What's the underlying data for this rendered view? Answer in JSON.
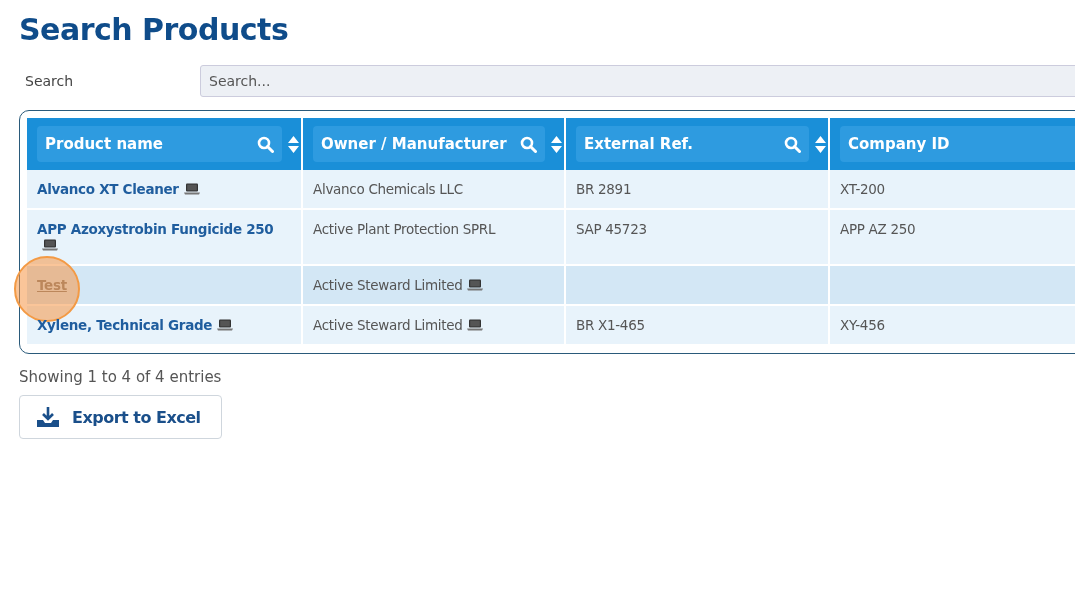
{
  "page": {
    "title": "Search Products"
  },
  "search": {
    "label": "Search",
    "placeholder": "Search..."
  },
  "table": {
    "columns": [
      {
        "label": "Product name"
      },
      {
        "label": "Owner / Manufacturer"
      },
      {
        "label": "External Ref."
      },
      {
        "label": "Company ID"
      }
    ],
    "rows": [
      {
        "highlighted": false,
        "cells": [
          {
            "text": "Alvanco XT Cleaner",
            "device_icon": true
          },
          {
            "text": "Alvanco Chemicals LLC",
            "device_icon": false
          },
          {
            "text": "BR 2891",
            "device_icon": false
          },
          {
            "text": "XT-200",
            "device_icon": false
          }
        ]
      },
      {
        "highlighted": false,
        "cells": [
          {
            "text": "APP Azoxystrobin Fungicide 250",
            "device_icon": true
          },
          {
            "text": "Active Plant Protection SPRL",
            "device_icon": false
          },
          {
            "text": "SAP 45723",
            "device_icon": false
          },
          {
            "text": "APP AZ 250",
            "device_icon": false
          }
        ]
      },
      {
        "highlighted": true,
        "cells": [
          {
            "text": "Test",
            "device_icon": false
          },
          {
            "text": "Active Steward Limited",
            "device_icon": true
          },
          {
            "text": "",
            "device_icon": false
          },
          {
            "text": "",
            "device_icon": false
          }
        ]
      },
      {
        "highlighted": false,
        "cells": [
          {
            "text": "Xylene, Technical Grade",
            "device_icon": true
          },
          {
            "text": "Active Steward Limited",
            "device_icon": true
          },
          {
            "text": "BR X1-465",
            "device_icon": false
          },
          {
            "text": "XY-456",
            "device_icon": false
          }
        ]
      }
    ]
  },
  "footer": {
    "info": "Showing 1 to 4 of 4 entries",
    "export_button": "Export to Excel"
  }
}
